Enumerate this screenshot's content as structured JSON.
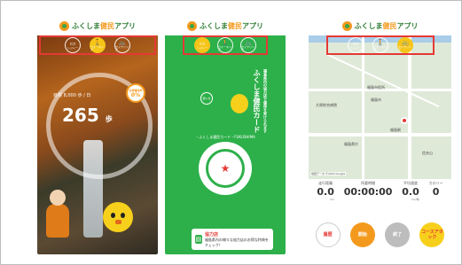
{
  "app": {
    "logo_plain": "ふくしま",
    "logo_accent": "健民",
    "logo_suffix": "アプリ"
  },
  "modes": [
    {
      "icon": "car-icon",
      "glyph": "▭",
      "label": "レジャー"
    },
    {
      "icon": "walking-icon",
      "glyph": "🚶",
      "label": "ウォーキング"
    },
    {
      "icon": "bicycle-icon",
      "glyph": "🚲",
      "label": "サイクリング"
    }
  ],
  "screen1": {
    "goal": "目標 8,000 歩 / 日",
    "steps_value": "265",
    "steps_unit": "歩",
    "achievement_label": "目標達成率",
    "achievement_value": "0%"
  },
  "screen2": {
    "card_title": "ふくしま健民カード",
    "card_sub": "福島県内の協力店で優待を受けられます",
    "seal_text": "・ふくしま健民カード・FUKUSHIMA",
    "seal_glyph": "★",
    "sub_button": "使い方",
    "shop_title": "協力店",
    "shop_text": "福島県内の様々な協力店のお得な特典をチェック！"
  },
  "screen3": {
    "map_labels": [
      "大原綜合病院",
      "福島市役所",
      "福島市",
      "福島駅",
      "福島県庁",
      "信夫山"
    ],
    "attribution": "地図データ ©2023 Google",
    "stats": [
      {
        "label": "走行距離",
        "value": "0.0",
        "unit": "km"
      },
      {
        "label": "所要時間",
        "value": "00:00:00",
        "unit": ""
      },
      {
        "label": "平均速度",
        "value": "0.0",
        "unit": "km/時"
      },
      {
        "label": "カロリー",
        "value": "0",
        "unit": ""
      }
    ],
    "buttons": [
      {
        "label": "履歴",
        "color": "#ffffff",
        "text_color": "#e53935",
        "name": "history-button"
      },
      {
        "label": "開始",
        "color": "#f39a1e",
        "text_color": "#ffffff",
        "name": "start-button"
      },
      {
        "label": "終了",
        "color": "#bdbdbd",
        "text_color": "#ffffff",
        "name": "end-button"
      },
      {
        "label": "コースアタック",
        "color": "#f7d01c",
        "text_color": "#e53935",
        "name": "course-attack-button"
      }
    ]
  }
}
